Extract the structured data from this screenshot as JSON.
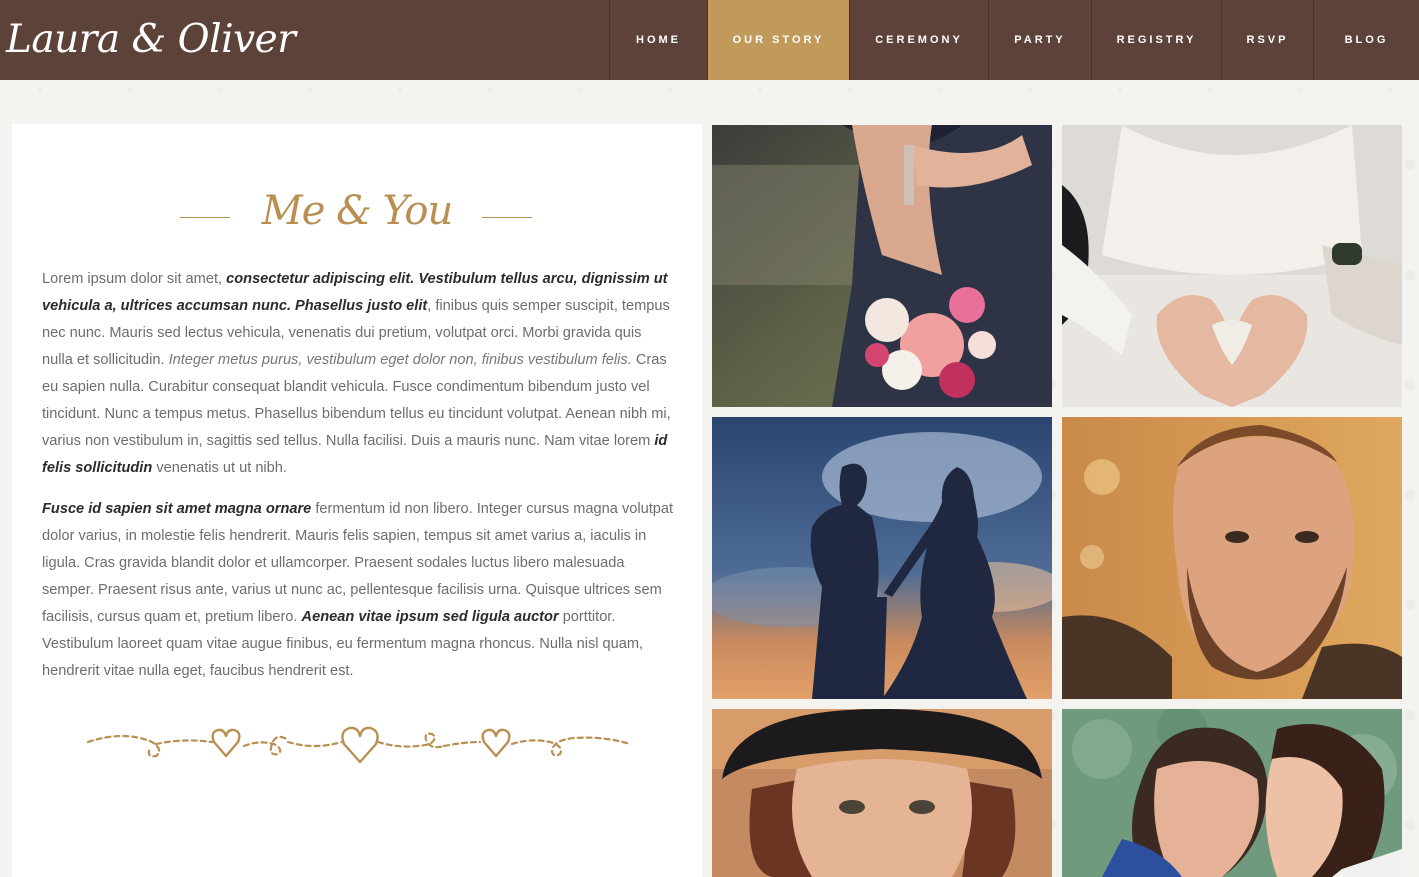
{
  "site": {
    "logo": "Laura & Oliver"
  },
  "nav": {
    "items": [
      {
        "label": "HOME",
        "active": false
      },
      {
        "label": "OUR STORY",
        "active": true
      },
      {
        "label": "CEREMONY",
        "active": false
      },
      {
        "label": "PARTY",
        "active": false
      },
      {
        "label": "REGISTRY",
        "active": false
      },
      {
        "label": "RSVP",
        "active": false
      },
      {
        "label": "BLOG",
        "active": false
      }
    ]
  },
  "story": {
    "heading": "Me & You",
    "paragraph1": {
      "t1": "Lorem ipsum dolor sit amet, ",
      "b1": "consectetur adipiscing elit. Vestibulum tellus arcu, dignissim ut vehicula a, ultrices accumsan nunc. Phasellus justo elit",
      "t2": ", finibus quis semper suscipit, tempus nec nunc. Mauris sed lectus vehicula, venenatis dui pretium, volutpat orci. Morbi gravida quis nulla et sollicitudin. ",
      "i1": "Integer metus purus, vestibulum eget dolor non, finibus vestibulum felis.",
      "t3": " Cras eu sapien nulla. Curabitur consequat blandit vehicula. Fusce condimentum bibendum justo vel tincidunt. Nunc a tempus metus. Phasellus bibendum tellus eu tincidunt volutpat. Aenean nibh mi, varius non vestibulum in, sagittis sed tellus. Nulla facilisi. Duis a mauris nunc. Nam vitae lorem ",
      "b2": "id felis sollicitudin",
      "t4": " venenatis ut ut nibh."
    },
    "paragraph2": {
      "b1": "Fusce id sapien sit amet magna ornare",
      "t1": " fermentum id non libero. Integer cursus magna volutpat dolor varius, in molestie felis hendrerit. Mauris felis sapien, tempus sit amet varius a, iaculis in ligula. Cras gravida blandit dolor et ullamcorper. Praesent sodales luctus libero malesuada semper. Praesent risus ante, varius ut nunc ac, pellentesque facilisis urna. Quisque ultrices sem facilisis, cursus quam et, pretium libero. ",
      "b2": "Aenean vitae ipsum sed ligula auctor",
      "t2": " porttitor. Vestibulum laoreet quam vitae augue finibus, eu fermentum magna rhoncus. Nulla nisl quam, hendrerit vitae nulla eget, faucibus hendrerit est."
    }
  },
  "gallery": {
    "photos": [
      {
        "subject": "bouquet-and-embrace"
      },
      {
        "subject": "hands-heart"
      },
      {
        "subject": "couple-silhouette-sunset"
      },
      {
        "subject": "bearded-man-portrait"
      },
      {
        "subject": "woman-in-hat-portrait"
      },
      {
        "subject": "couple-close-embrace"
      }
    ]
  },
  "colors": {
    "header_bg": "#5d423a",
    "accent_gold": "#c19a5b",
    "heading_gold": "#b98f52",
    "body_text": "#6d6d6d"
  }
}
